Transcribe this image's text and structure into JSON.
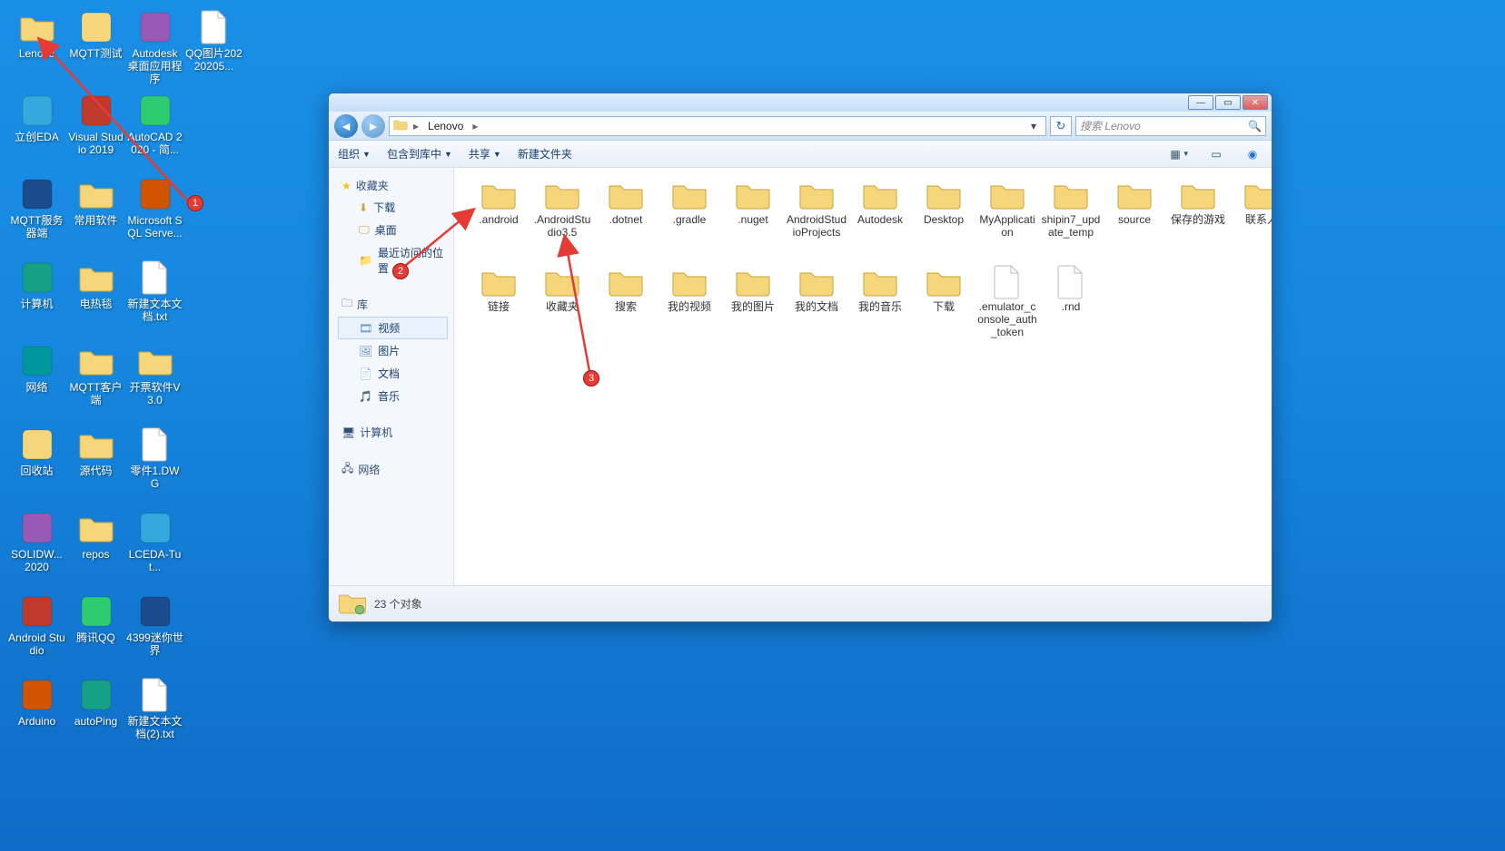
{
  "desktopIcons": [
    [
      "Lenovo",
      "MQTT测试",
      "Autodesk 桌面应用程序",
      "QQ图片20220205..."
    ],
    [
      "立创EDA",
      "Visual Studio 2019",
      "AutoCAD 2020 - 简...",
      ""
    ],
    [
      "MQTT服务器端",
      "常用软件",
      "Microsoft SQL Serve...",
      ""
    ],
    [
      "计算机",
      "电热毯",
      "新建文本文档.txt",
      ""
    ],
    [
      "网络",
      "MQTT客户端",
      "开票软件V3.0",
      ""
    ],
    [
      "回收站",
      "源代码",
      "零件1.DWG",
      ""
    ],
    [
      "SOLIDW... 2020",
      "repos",
      "LCEDA-Tut...",
      ""
    ],
    [
      "Android Studio",
      "腾讯QQ",
      "4399迷你世界",
      ""
    ],
    [
      "Arduino",
      "autoPing",
      "新建文本文档(2).txt",
      ""
    ]
  ],
  "explorer": {
    "breadcrumb": [
      "Lenovo"
    ],
    "breadcrumb_label": "Lenovo",
    "searchPlaceholder": "搜索 Lenovo",
    "toolbar": {
      "organize": "组织",
      "include": "包含到库中",
      "share": "共享",
      "newFolder": "新建文件夹"
    },
    "sidebar": {
      "favorites": {
        "title": "收藏夹",
        "items": [
          "下载",
          "桌面",
          "最近访问的位置"
        ]
      },
      "libraries": {
        "title": "库",
        "items": [
          "视频",
          "图片",
          "文档",
          "音乐"
        ]
      },
      "computer": {
        "title": "计算机"
      },
      "network": {
        "title": "网络"
      }
    },
    "files": [
      ".android",
      ".AndroidStudio3.5",
      ".dotnet",
      ".gradle",
      ".nuget",
      "AndroidStudioProjects",
      "Autodesk",
      "Desktop",
      "MyApplication",
      "shipin7_update_temp",
      "source",
      "保存的游戏",
      "联系人",
      "链接",
      "收藏夹",
      "搜索",
      "我的视频",
      "我的图片",
      "我的文档",
      "我的音乐",
      "下载",
      ".emulator_console_auth_token",
      ".rnd"
    ],
    "fileFolderCount": 21,
    "status": "23 个对象"
  },
  "annotations": {
    "b1": "1",
    "b2": "2",
    "b3": "3"
  }
}
